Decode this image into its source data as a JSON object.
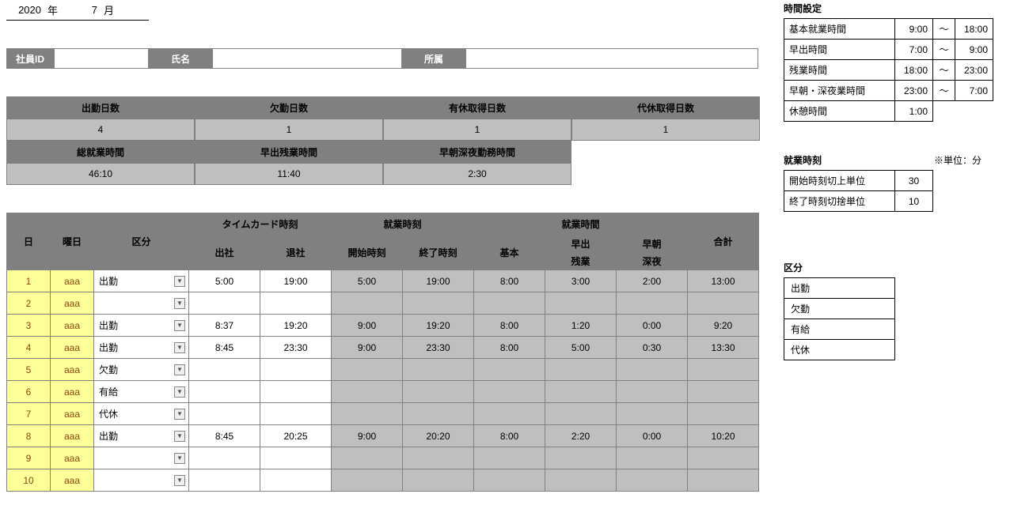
{
  "date": {
    "year": "2020",
    "year_unit": "年",
    "month": "7",
    "month_unit": "月"
  },
  "employee": {
    "id_label": "社員ID",
    "id": "",
    "name_label": "氏名",
    "name": "",
    "dept_label": "所属",
    "dept": ""
  },
  "summary": {
    "attend_label": "出勤日数",
    "attend": "4",
    "absent_label": "欠勤日数",
    "absent": "1",
    "paid_label": "有休取得日数",
    "paid": "1",
    "comp_label": "代休取得日数",
    "comp": "1",
    "total_hours_label": "総就業時間",
    "total_hours": "46:10",
    "ot_label": "早出残業時間",
    "ot": "11:40",
    "night_label": "早朝深夜勤務時間",
    "night": "2:30"
  },
  "table": {
    "hdr_day": "日",
    "hdr_dow": "曜日",
    "hdr_kubun": "区分",
    "hdr_timecard": "タイムカード時刻",
    "hdr_in": "出社",
    "hdr_out": "退社",
    "hdr_worktime": "就業時刻",
    "hdr_start": "開始時刻",
    "hdr_end": "終了時刻",
    "hdr_workhours": "就業時間",
    "hdr_base": "基本",
    "hdr_hayade_top": "早出",
    "hdr_hayade_bot": "残業",
    "hdr_socho_top": "早朝",
    "hdr_socho_bot": "深夜",
    "hdr_total": "合計",
    "rows": [
      {
        "d": "1",
        "dow": "aaa",
        "kubun": "出勤",
        "in": "5:00",
        "out": "19:00",
        "start": "5:00",
        "end": "19:00",
        "base": "8:00",
        "ot": "3:00",
        "night": "2:00",
        "total": "13:00"
      },
      {
        "d": "2",
        "dow": "aaa",
        "kubun": "",
        "in": "",
        "out": "",
        "start": "",
        "end": "",
        "base": "",
        "ot": "",
        "night": "",
        "total": ""
      },
      {
        "d": "3",
        "dow": "aaa",
        "kubun": "出勤",
        "in": "8:37",
        "out": "19:20",
        "start": "9:00",
        "end": "19:20",
        "base": "8:00",
        "ot": "1:20",
        "night": "0:00",
        "total": "9:20"
      },
      {
        "d": "4",
        "dow": "aaa",
        "kubun": "出勤",
        "in": "8:45",
        "out": "23:30",
        "start": "9:00",
        "end": "23:30",
        "base": "8:00",
        "ot": "5:00",
        "night": "0:30",
        "total": "13:30"
      },
      {
        "d": "5",
        "dow": "aaa",
        "kubun": "欠勤",
        "in": "",
        "out": "",
        "start": "",
        "end": "",
        "base": "",
        "ot": "",
        "night": "",
        "total": ""
      },
      {
        "d": "6",
        "dow": "aaa",
        "kubun": "有給",
        "in": "",
        "out": "",
        "start": "",
        "end": "",
        "base": "",
        "ot": "",
        "night": "",
        "total": ""
      },
      {
        "d": "7",
        "dow": "aaa",
        "kubun": "代休",
        "in": "",
        "out": "",
        "start": "",
        "end": "",
        "base": "",
        "ot": "",
        "night": "",
        "total": ""
      },
      {
        "d": "8",
        "dow": "aaa",
        "kubun": "出勤",
        "in": "8:45",
        "out": "20:25",
        "start": "9:00",
        "end": "20:20",
        "base": "8:00",
        "ot": "2:20",
        "night": "0:00",
        "total": "10:20"
      },
      {
        "d": "9",
        "dow": "aaa",
        "kubun": "",
        "in": "",
        "out": "",
        "start": "",
        "end": "",
        "base": "",
        "ot": "",
        "night": "",
        "total": ""
      },
      {
        "d": "10",
        "dow": "aaa",
        "kubun": "",
        "in": "",
        "out": "",
        "start": "",
        "end": "",
        "base": "",
        "ot": "",
        "night": "",
        "total": ""
      }
    ]
  },
  "time_settings": {
    "title": "時間設定",
    "basic_label": "基本就業時間",
    "basic_from": "9:00",
    "basic_to": "18:00",
    "early_label": "早出時間",
    "early_from": "7:00",
    "early_to": "9:00",
    "ot_label": "残業時間",
    "ot_from": "18:00",
    "ot_to": "23:00",
    "night_label": "早朝・深夜業時間",
    "night_from": "23:00",
    "night_to": "7:00",
    "break_label": "休憩時間",
    "break": "1:00",
    "tilde": "～"
  },
  "work_time_settings": {
    "title": "就業時刻",
    "unit_note": "※単位：分",
    "start_label": "開始時刻切上単位",
    "start": "30",
    "end_label": "終了時刻切捨単位",
    "end": "10"
  },
  "kubun": {
    "title": "区分",
    "items": [
      "出勤",
      "欠勤",
      "有給",
      "代休"
    ]
  }
}
